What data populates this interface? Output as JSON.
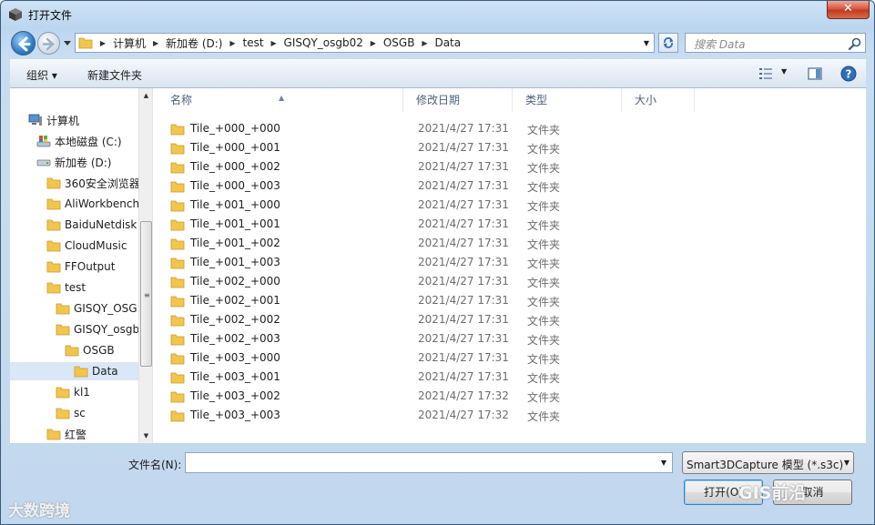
{
  "window": {
    "title": "打开文件",
    "close_label": "✕"
  },
  "address": {
    "crumbs": [
      "计算机",
      "新加卷 (D:)",
      "test",
      "GISQY_osgb02",
      "OSGB",
      "Data"
    ]
  },
  "search": {
    "placeholder": "搜索 Data"
  },
  "toolbar": {
    "organize_label": "组织 ▾",
    "new_folder_label": "新建文件夹"
  },
  "nav": {
    "items": [
      {
        "label": "计算机",
        "icon": "computer-icon"
      },
      {
        "label": "本地磁盘 (C:)",
        "icon": "drive-c-icon"
      },
      {
        "label": "新加卷 (D:)",
        "icon": "drive-icon"
      },
      {
        "label": "360安全浏览器",
        "icon": "folder-icon"
      },
      {
        "label": "AliWorkbench",
        "icon": "folder-icon"
      },
      {
        "label": "BaiduNetdisk",
        "icon": "folder-icon"
      },
      {
        "label": "CloudMusic",
        "icon": "folder-icon"
      },
      {
        "label": "FFOutput",
        "icon": "folder-icon"
      },
      {
        "label": "test",
        "icon": "folder-icon"
      },
      {
        "label": "GISQY_OSG",
        "icon": "folder-icon"
      },
      {
        "label": "GISQY_osgb",
        "icon": "folder-icon"
      },
      {
        "label": "OSGB",
        "icon": "folder-icon"
      },
      {
        "label": "Data",
        "icon": "folder-icon",
        "selected": true
      },
      {
        "label": "kl1",
        "icon": "folder-icon"
      },
      {
        "label": "sc",
        "icon": "folder-icon"
      },
      {
        "label": "红警",
        "icon": "folder-icon"
      }
    ]
  },
  "columns": {
    "name": "名称",
    "date": "修改日期",
    "type": "类型",
    "size": "大小"
  },
  "files": [
    {
      "name": "Tile_+000_+000",
      "date": "2021/4/27 17:31",
      "type": "文件夹"
    },
    {
      "name": "Tile_+000_+001",
      "date": "2021/4/27 17:31",
      "type": "文件夹"
    },
    {
      "name": "Tile_+000_+002",
      "date": "2021/4/27 17:31",
      "type": "文件夹"
    },
    {
      "name": "Tile_+000_+003",
      "date": "2021/4/27 17:31",
      "type": "文件夹"
    },
    {
      "name": "Tile_+001_+000",
      "date": "2021/4/27 17:31",
      "type": "文件夹"
    },
    {
      "name": "Tile_+001_+001",
      "date": "2021/4/27 17:31",
      "type": "文件夹"
    },
    {
      "name": "Tile_+001_+002",
      "date": "2021/4/27 17:31",
      "type": "文件夹"
    },
    {
      "name": "Tile_+001_+003",
      "date": "2021/4/27 17:31",
      "type": "文件夹"
    },
    {
      "name": "Tile_+002_+000",
      "date": "2021/4/27 17:31",
      "type": "文件夹"
    },
    {
      "name": "Tile_+002_+001",
      "date": "2021/4/27 17:31",
      "type": "文件夹"
    },
    {
      "name": "Tile_+002_+002",
      "date": "2021/4/27 17:31",
      "type": "文件夹"
    },
    {
      "name": "Tile_+002_+003",
      "date": "2021/4/27 17:31",
      "type": "文件夹"
    },
    {
      "name": "Tile_+003_+000",
      "date": "2021/4/27 17:31",
      "type": "文件夹"
    },
    {
      "name": "Tile_+003_+001",
      "date": "2021/4/27 17:31",
      "type": "文件夹"
    },
    {
      "name": "Tile_+003_+002",
      "date": "2021/4/27 17:32",
      "type": "文件夹"
    },
    {
      "name": "Tile_+003_+003",
      "date": "2021/4/27 17:32",
      "type": "文件夹"
    }
  ],
  "footer": {
    "filename_label": "文件名(N):",
    "filename_value": "",
    "filetype_value": "Smart3DCapture 模型 (*.s3c)",
    "open_label": "打开(O)",
    "cancel_label": "取消"
  },
  "watermarks": {
    "left": "大数跨境",
    "right": "GIS前沿"
  },
  "colors": {
    "accent": "#3c7fb1",
    "selection": "#d9e7f6",
    "folder": "#f2c54d"
  }
}
